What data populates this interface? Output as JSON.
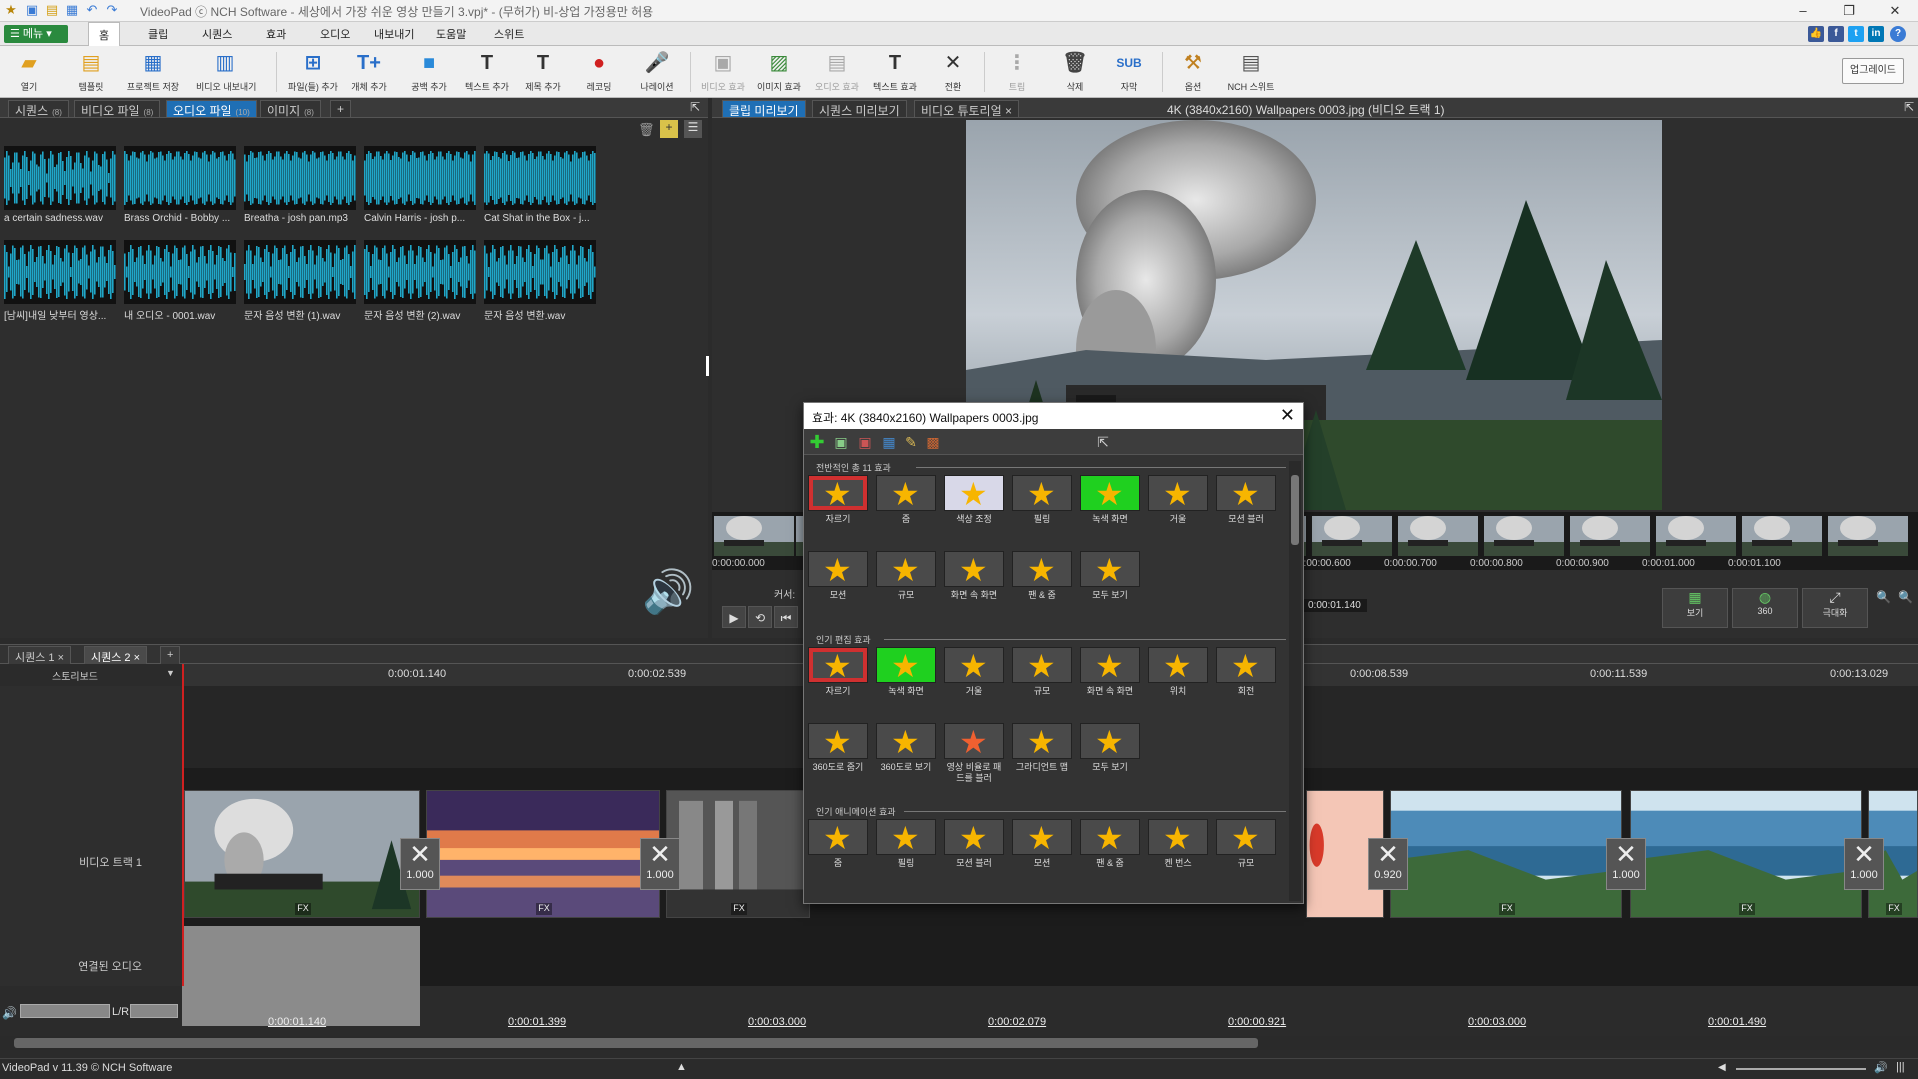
{
  "window": {
    "title": "VideoPad ⓒ NCH Software - 세상에서 가장 쉬운 영상 만들기 3.vpj* - (무허가) 비-상업 가정용만 허용"
  },
  "menu": {
    "menu_button": "메뉴",
    "tabs": [
      "홈",
      "클립",
      "시퀀스",
      "효과",
      "오디오",
      "내보내기",
      "도움말",
      "스위트"
    ]
  },
  "toolbar": {
    "items": [
      {
        "label": "열기",
        "icon": "open-folder-icon"
      },
      {
        "label": "템플릿",
        "icon": "template-icon"
      },
      {
        "label": "프로젝트 저장",
        "icon": "save-icon"
      },
      {
        "label": "비디오 내보내기",
        "icon": "export-video-icon"
      },
      {
        "label": "파일(들) 추가",
        "icon": "add-files-icon"
      },
      {
        "label": "개체 추가",
        "icon": "add-object-icon"
      },
      {
        "label": "공백 추가",
        "icon": "add-blank-icon"
      },
      {
        "label": "텍스트 추가",
        "icon": "add-text-icon"
      },
      {
        "label": "제목 추가",
        "icon": "add-title-icon"
      },
      {
        "label": "레코딩",
        "icon": "record-icon"
      },
      {
        "label": "나레이션",
        "icon": "narration-icon"
      },
      {
        "label": "비디오 효과",
        "icon": "video-effect-icon"
      },
      {
        "label": "이미지 효과",
        "icon": "image-effect-icon"
      },
      {
        "label": "오디오 효과",
        "icon": "audio-effect-icon"
      },
      {
        "label": "텍스트 효과",
        "icon": "text-effect-icon"
      },
      {
        "label": "전환",
        "icon": "transition-icon"
      },
      {
        "label": "트림",
        "icon": "trim-icon"
      },
      {
        "label": "삭제",
        "icon": "delete-icon"
      },
      {
        "label": "자막",
        "icon": "subtitle-icon"
      },
      {
        "label": "옵션",
        "icon": "options-icon"
      },
      {
        "label": "NCH 스위트",
        "icon": "nch-suite-icon"
      }
    ],
    "upgrade": "업그레이드"
  },
  "bin": {
    "tabs": [
      {
        "label": "시퀀스",
        "count": "(8)"
      },
      {
        "label": "비디오 파일",
        "count": "(8)"
      },
      {
        "label": "오디오 파일",
        "count": "(10)"
      },
      {
        "label": "이미지",
        "count": "(8)"
      }
    ],
    "add_tab": "+",
    "clips": [
      "a certain sadness.wav",
      "Brass Orchid - Bobby ...",
      "Breatha - josh pan.mp3",
      "Calvin Harris - josh p...",
      "Cat Shat in the Box - j...",
      "[남씨]내일 낮부터 영상...",
      "내 오디오 - 0001.wav",
      "문자 음성 변환 (1).wav",
      "문자 음성 변환 (2).wav",
      "문자 음성 변환.wav"
    ]
  },
  "preview": {
    "tabs": [
      "클립 미리보기",
      "시퀀스 미리보기",
      "비디오 튜토리얼"
    ],
    "title": "4K (3840x2160) Wallpapers 0003.jpg (비디오 트랙 1)",
    "filmstrip_times": [
      "0:00:00.000",
      "0:00:00.600",
      "0:00:00.700",
      "0:00:00.800",
      "0:00:00.900",
      "0:00:01.000",
      "0:00:01.100"
    ],
    "cursor_label": "커서:",
    "cursor_value": "0:00:01.140",
    "view_buttons": [
      {
        "label": "보기",
        "icon": "view-icon"
      },
      {
        "label": "360",
        "icon": "360-icon"
      },
      {
        "label": "극대화",
        "icon": "maximize-icon"
      }
    ]
  },
  "effects_dialog": {
    "title": "효과: 4K (3840x2160) Wallpapers 0003.jpg",
    "sections": [
      {
        "title": "전반적인 총 11 효과",
        "items": [
          "자르기",
          "줌",
          "색상 조정",
          "필링",
          "녹색 화면",
          "거울",
          "모션 블러",
          "모션",
          "규모",
          "화면 속 화면",
          "팬 & 줌",
          "모두 보기"
        ]
      },
      {
        "title": "인기 편집 효과",
        "items": [
          "자르기",
          "녹색 화면",
          "거울",
          "규모",
          "화면 속 화면",
          "위치",
          "회전",
          "360도로 줌기",
          "360도로 보기",
          "영상 비율로 패드를 블러",
          "그라디언트 맵",
          "모두 보기"
        ]
      },
      {
        "title": "인기 애니메이션 효과",
        "items": [
          "줌",
          "필링",
          "모션 블러",
          "모션",
          "팬 & 줌",
          "켄 번스",
          "규모"
        ]
      }
    ]
  },
  "timeline": {
    "sequence_tabs": [
      "시퀀스 1",
      "시퀀스 2"
    ],
    "storyboard_label": "스토리보드",
    "ruler_marks": [
      "0:00:01.140",
      "0:00:02.539",
      "0:00:08.539",
      "0:00:11.539",
      "0:00:13.029"
    ],
    "video_track_label": "비디오 트랙 1",
    "audio_track_label": "연결된 오디오",
    "lr_label": "L/R",
    "transitions": [
      "1.000",
      "1.000",
      "0.920",
      "1.000",
      "1.000"
    ],
    "durations": [
      "0:00:01.140",
      "0:00:01.399",
      "0:00:03.000",
      "0:00:02.079",
      "0:00:00.921",
      "0:00:03.000",
      "0:00:01.490"
    ],
    "fx_badge": "FX"
  },
  "status": {
    "version": "VideoPad v 11.39 © NCH Software"
  }
}
